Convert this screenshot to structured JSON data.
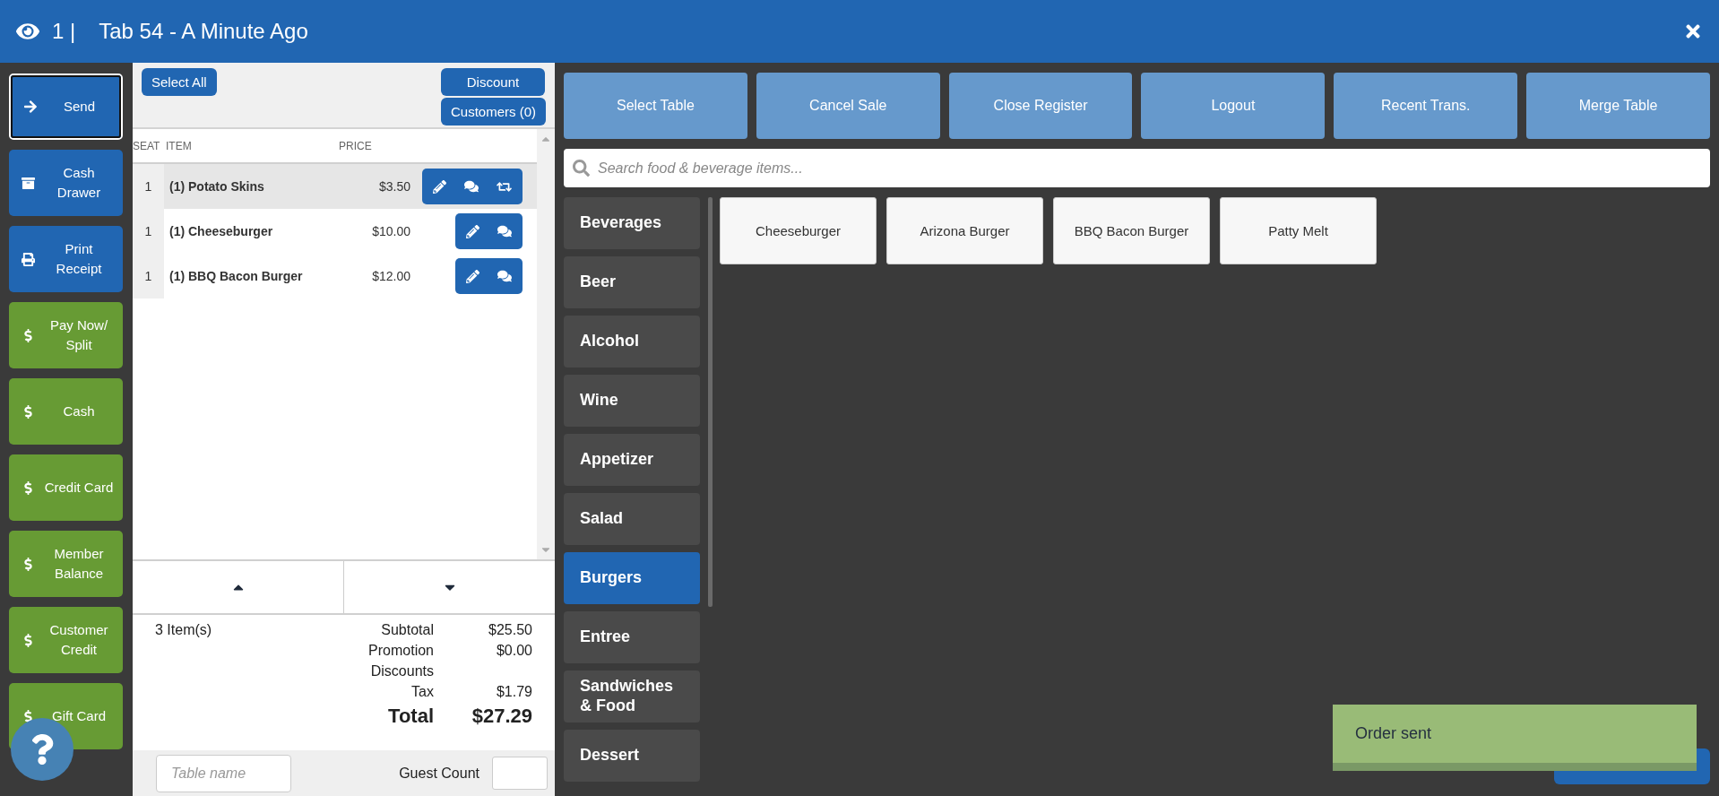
{
  "header": {
    "counter": "1 |",
    "title": "Tab 54 - A Minute Ago"
  },
  "sidebar_actions": [
    {
      "label": "Send",
      "kind": "send",
      "focused": true
    },
    {
      "label": "Cash Drawer",
      "kind": "drawer",
      "focused": false
    },
    {
      "label": "Print Receipt",
      "kind": "print",
      "focused": false
    },
    {
      "label": "Pay Now/ Split",
      "kind": "payment",
      "focused": false
    },
    {
      "label": "Cash",
      "kind": "payment",
      "focused": false
    },
    {
      "label": "Credit Card",
      "kind": "payment",
      "focused": false
    },
    {
      "label": "Member Balance",
      "kind": "payment",
      "focused": false
    },
    {
      "label": "Customer Credit",
      "kind": "payment",
      "focused": false
    },
    {
      "label": "Gift Card",
      "kind": "payment",
      "focused": false
    }
  ],
  "order": {
    "select_all": "Select All",
    "discount": "Discount",
    "customers": "Customers (0)",
    "columns": [
      "SEAT",
      "ITEM",
      "PRICE"
    ],
    "rows": [
      {
        "seat": "1",
        "item": "(1) Potato Skins",
        "price": "$3.50",
        "selected": true,
        "repeatable": true
      },
      {
        "seat": "1",
        "item": "(1) Cheeseburger",
        "price": "$10.00",
        "selected": false,
        "repeatable": false
      },
      {
        "seat": "1",
        "item": "(1) BBQ Bacon Burger",
        "price": "$12.00",
        "selected": false,
        "repeatable": false
      }
    ],
    "item_count": "3 Item(s)",
    "summary": [
      {
        "label": "Subtotal",
        "value": "$25.50"
      },
      {
        "label": "Promotion",
        "value": "$0.00"
      },
      {
        "label": "Discounts"
      },
      {
        "label": "Tax",
        "value": "$1.79"
      }
    ],
    "total": {
      "label": "Total",
      "value": "$27.29"
    },
    "table_name": {
      "placeholder": "Table name"
    },
    "guest_count": {
      "label": "Guest Count"
    }
  },
  "top_actions": [
    "Select Table",
    "Cancel Sale",
    "Close Register",
    "Logout",
    "Recent Trans.",
    "Merge Table"
  ],
  "search": {
    "placeholder": "Search food & beverage items..."
  },
  "categories": [
    {
      "label": "Beverages",
      "selected": false
    },
    {
      "label": "Beer",
      "selected": false
    },
    {
      "label": "Alcohol",
      "selected": false
    },
    {
      "label": "Wine",
      "selected": false
    },
    {
      "label": "Appetizer",
      "selected": false
    },
    {
      "label": "Salad",
      "selected": false
    },
    {
      "label": "Burgers",
      "selected": true
    },
    {
      "label": "Entree",
      "selected": false
    },
    {
      "label": "Sandwiches & Food",
      "selected": false
    },
    {
      "label": "Dessert",
      "selected": false
    }
  ],
  "menu_items": [
    "Cheeseburger",
    "Arizona Burger",
    "BBQ Bacon Burger",
    "Patty Melt"
  ],
  "toast": {
    "message": "Order sent"
  }
}
